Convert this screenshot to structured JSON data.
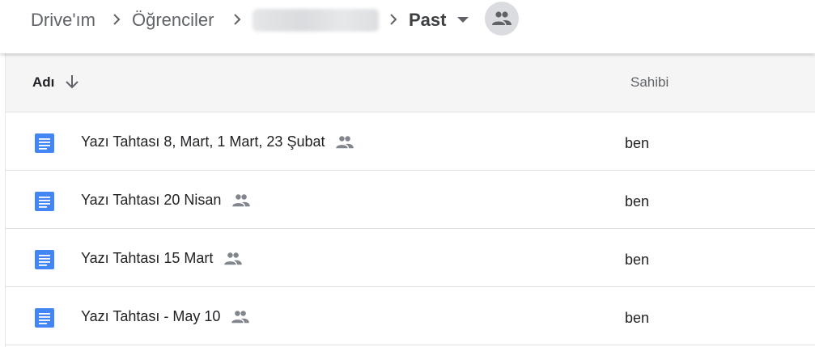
{
  "breadcrumb": {
    "items": [
      "Drive'ım",
      "Öğrenciler"
    ],
    "current": "Past"
  },
  "columns": {
    "name": "Adı",
    "owner": "Sahibi"
  },
  "files": [
    {
      "name": "Yazı Tahtası 8, Mart, 1 Mart, 23 Şubat",
      "owner": "ben",
      "shared": true
    },
    {
      "name": "Yazı Tahtası 20 Nisan",
      "owner": "ben",
      "shared": true
    },
    {
      "name": "Yazı Tahtası 15 Mart",
      "owner": "ben",
      "shared": true
    },
    {
      "name": "Yazı Tahtası - May 10",
      "owner": "ben",
      "shared": true
    }
  ],
  "colors": {
    "doc_icon": "#4285f4",
    "icon_gray": "#80868b",
    "header_bg": "#f5f5f5"
  },
  "icons": {
    "doc": "google-docs-icon",
    "shared": "people-icon",
    "sort": "arrow-down-icon",
    "separator": "chevron-right-icon"
  }
}
